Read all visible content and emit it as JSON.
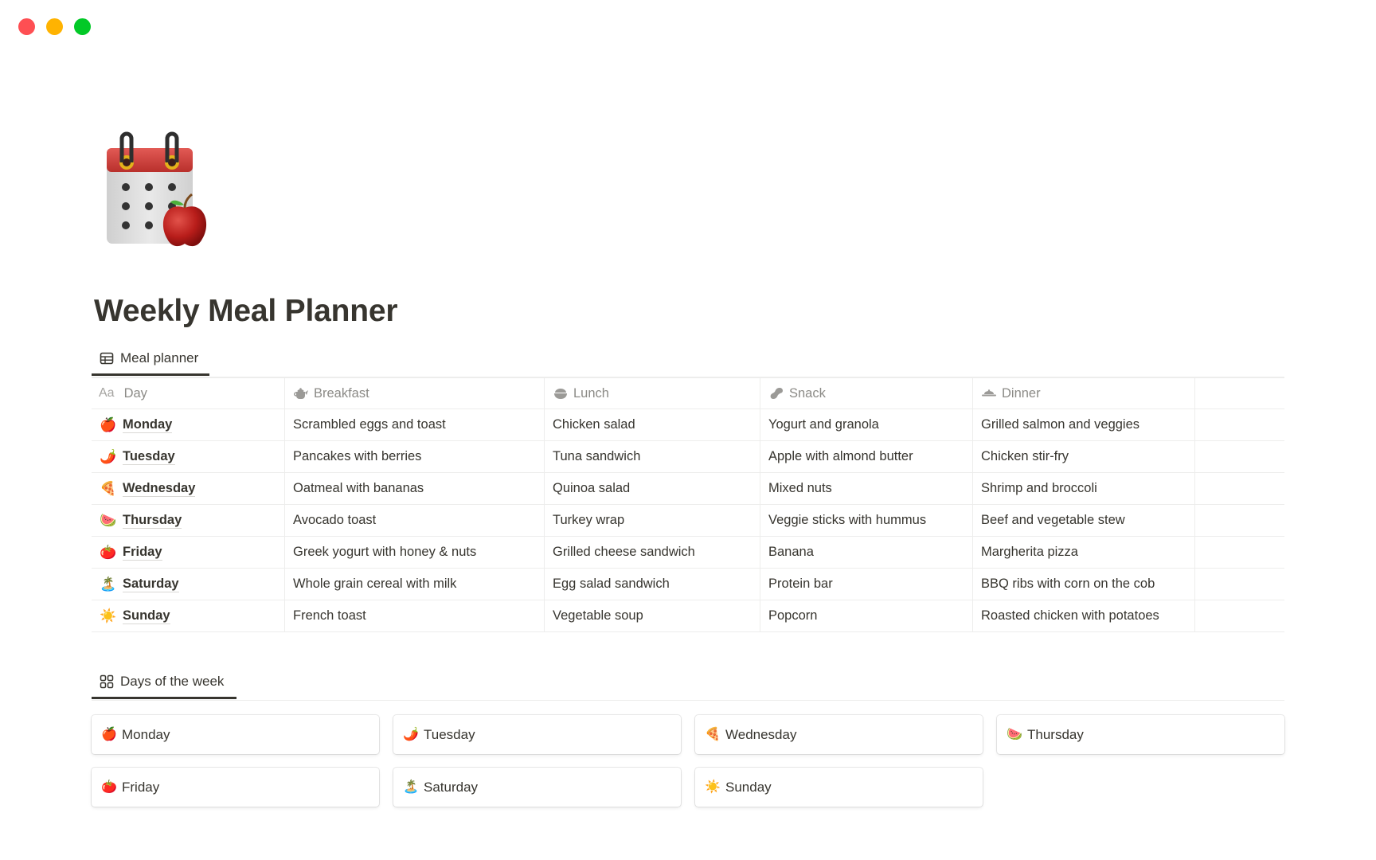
{
  "window": {
    "controls": [
      "close",
      "minimize",
      "maximize"
    ]
  },
  "page": {
    "icon": "calendar-with-apple-icon",
    "title": "Weekly Meal Planner"
  },
  "meal_view": {
    "tab_label": "Meal planner",
    "tab_icon": "table-icon",
    "columns": [
      {
        "key": "day",
        "label": "Day",
        "icon": "text-aa-icon",
        "icon_text": "Aa"
      },
      {
        "key": "breakfast",
        "label": "Breakfast",
        "icon": "teapot-icon"
      },
      {
        "key": "lunch",
        "label": "Lunch",
        "icon": "bowl-icon"
      },
      {
        "key": "snack",
        "label": "Snack",
        "icon": "peanut-icon"
      },
      {
        "key": "dinner",
        "label": "Dinner",
        "icon": "dish-icon"
      }
    ],
    "rows": [
      {
        "emoji": "🍎",
        "emoji_name": "apple-icon",
        "day": "Monday",
        "breakfast": "Scrambled eggs and toast",
        "lunch": "Chicken salad",
        "snack": "Yogurt and granola",
        "dinner": "Grilled salmon and veggies"
      },
      {
        "emoji": "🌶️",
        "emoji_name": "chili-pepper-icon",
        "day": "Tuesday",
        "breakfast": "Pancakes with berries",
        "lunch": "Tuna sandwich",
        "snack": "Apple with almond butter",
        "dinner": "Chicken stir-fry"
      },
      {
        "emoji": "🍕",
        "emoji_name": "pizza-icon",
        "day": "Wednesday",
        "breakfast": "Oatmeal with bananas",
        "lunch": "Quinoa salad",
        "snack": "Mixed nuts",
        "dinner": "Shrimp and broccoli"
      },
      {
        "emoji": "🍉",
        "emoji_name": "watermelon-icon",
        "day": "Thursday",
        "breakfast": "Avocado toast",
        "lunch": "Turkey wrap",
        "snack": "Veggie sticks with hummus",
        "dinner": "Beef and vegetable stew"
      },
      {
        "emoji": "🍅",
        "emoji_name": "tomato-icon",
        "day": "Friday",
        "breakfast": "Greek yogurt with honey & nuts",
        "lunch": "Grilled cheese sandwich",
        "snack": "Banana",
        "dinner": "Margherita pizza"
      },
      {
        "emoji": "🏝️",
        "emoji_name": "beach-island-icon",
        "day": "Saturday",
        "breakfast": "Whole grain cereal with milk",
        "lunch": "Egg salad sandwich",
        "snack": "Protein bar",
        "dinner": "BBQ ribs with corn on the cob"
      },
      {
        "emoji": "☀️",
        "emoji_name": "sun-icon",
        "day": "Sunday",
        "breakfast": "French toast",
        "lunch": "Vegetable soup",
        "snack": "Popcorn",
        "dinner": "Roasted chicken with potatoes"
      }
    ]
  },
  "days_view": {
    "tab_label": "Days of the week",
    "tab_icon": "gallery-grid-icon",
    "cards": [
      {
        "emoji": "🍎",
        "emoji_name": "apple-icon",
        "label": "Monday"
      },
      {
        "emoji": "🌶️",
        "emoji_name": "chili-pepper-icon",
        "label": "Tuesday"
      },
      {
        "emoji": "🍕",
        "emoji_name": "pizza-icon",
        "label": "Wednesday"
      },
      {
        "emoji": "🍉",
        "emoji_name": "watermelon-icon",
        "label": "Thursday"
      },
      {
        "emoji": "🍅",
        "emoji_name": "tomato-icon",
        "label": "Friday"
      },
      {
        "emoji": "🏝️",
        "emoji_name": "beach-island-icon",
        "label": "Saturday"
      },
      {
        "emoji": "☀️",
        "emoji_name": "sun-icon",
        "label": "Sunday"
      }
    ]
  },
  "colors": {
    "text": "#37352f",
    "muted": "#8b8a86",
    "border": "#ededec",
    "close": "#fe4f53",
    "minimize": "#ffb301",
    "maximize": "#02c927"
  }
}
